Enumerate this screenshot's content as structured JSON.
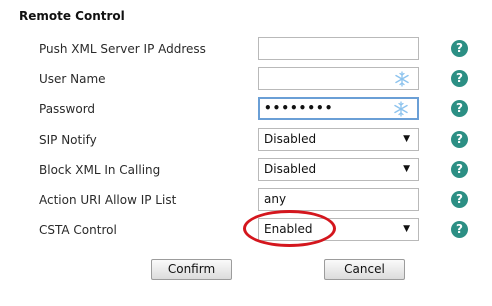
{
  "section": {
    "title": "Remote Control"
  },
  "fields": {
    "push_xml_server_ip": {
      "label": "Push XML Server IP Address",
      "value": ""
    },
    "user_name": {
      "label": "User Name",
      "value": ""
    },
    "password": {
      "label": "Password",
      "value": "••••••••"
    },
    "sip_notify": {
      "label": "SIP Notify",
      "value": "Disabled",
      "arrow": "▼"
    },
    "block_xml_in_calling": {
      "label": "Block XML In Calling",
      "value": "Disabled",
      "arrow": "▼"
    },
    "action_uri_allow_ip_list": {
      "label": "Action URI Allow IP List",
      "value": "any"
    },
    "csta_control": {
      "label": "CSTA Control",
      "value": "Enabled",
      "arrow": "▼"
    }
  },
  "help": {
    "glyph": "?",
    "icon": "help-icon",
    "color": "#2c8f84"
  },
  "buttons": {
    "confirm": "Confirm",
    "cancel": "Cancel"
  },
  "annotation": {
    "highlight_color": "#d4161d",
    "highlight_target": "csta_control"
  }
}
